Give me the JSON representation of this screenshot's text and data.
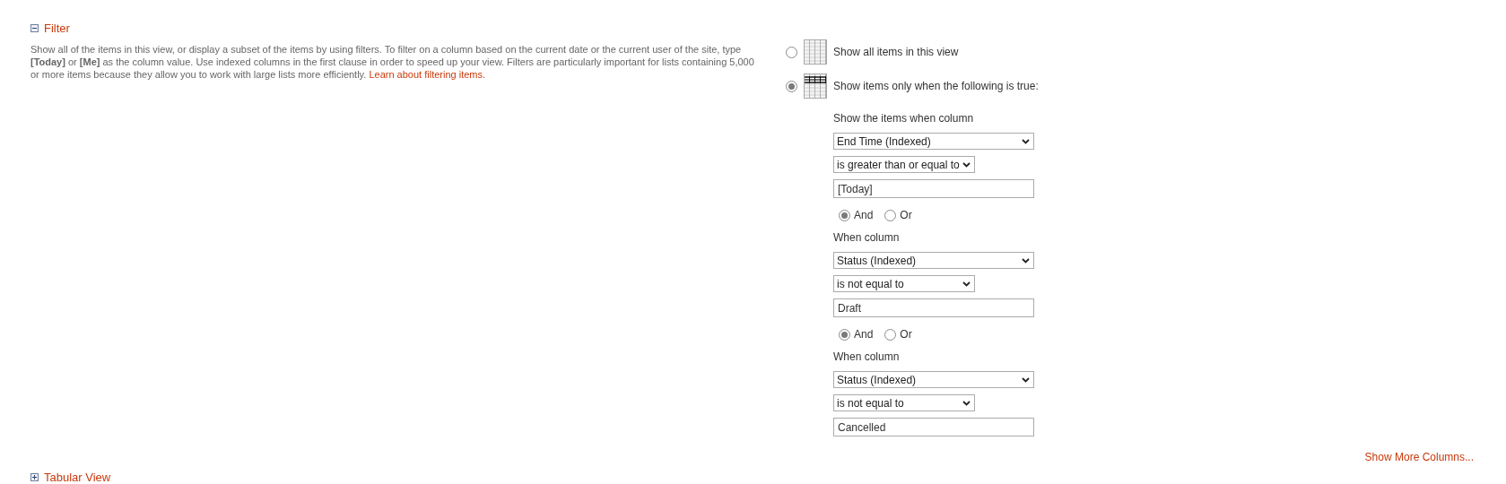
{
  "section": {
    "title": "Filter",
    "expanded": true,
    "description": "Show all of the items in this view, or display a subset of the items by using filters. To filter on a column based on the current date or the current user of the site, type **[Today]** or **[Me]** as the column value. Use indexed columns in the first clause in order to speed up your view. Filters are particularly important for lists containing 5,000 or more items because they allow you to work with large lists more efficiently.",
    "link": "Learn about filtering items."
  },
  "options": [
    {
      "label": "Show all items in this view",
      "selected": false,
      "kind": "all"
    },
    {
      "label": "Show items only when the following is true:",
      "selected": true,
      "kind": "filtered"
    }
  ],
  "clauses": [
    {
      "label": "Show the items when column",
      "column": "End Time (Indexed)",
      "operator": "is greater than or equal to",
      "value": "[Today]",
      "connector": [
        {
          "label": "And",
          "selected": true
        },
        {
          "label": "Or",
          "selected": false
        }
      ]
    },
    {
      "label": "When column",
      "column": "Status (Indexed)",
      "operator": "is not equal to",
      "value": "Draft",
      "connector": [
        {
          "label": "And",
          "selected": true
        },
        {
          "label": "Or",
          "selected": false
        }
      ]
    },
    {
      "label": "When column",
      "column": "Status (Indexed)",
      "operator": "is not equal to",
      "value": "Cancelled"
    }
  ],
  "more_link": "Show More Columns...",
  "next_section": {
    "title": "Tabular View",
    "expanded": false
  }
}
